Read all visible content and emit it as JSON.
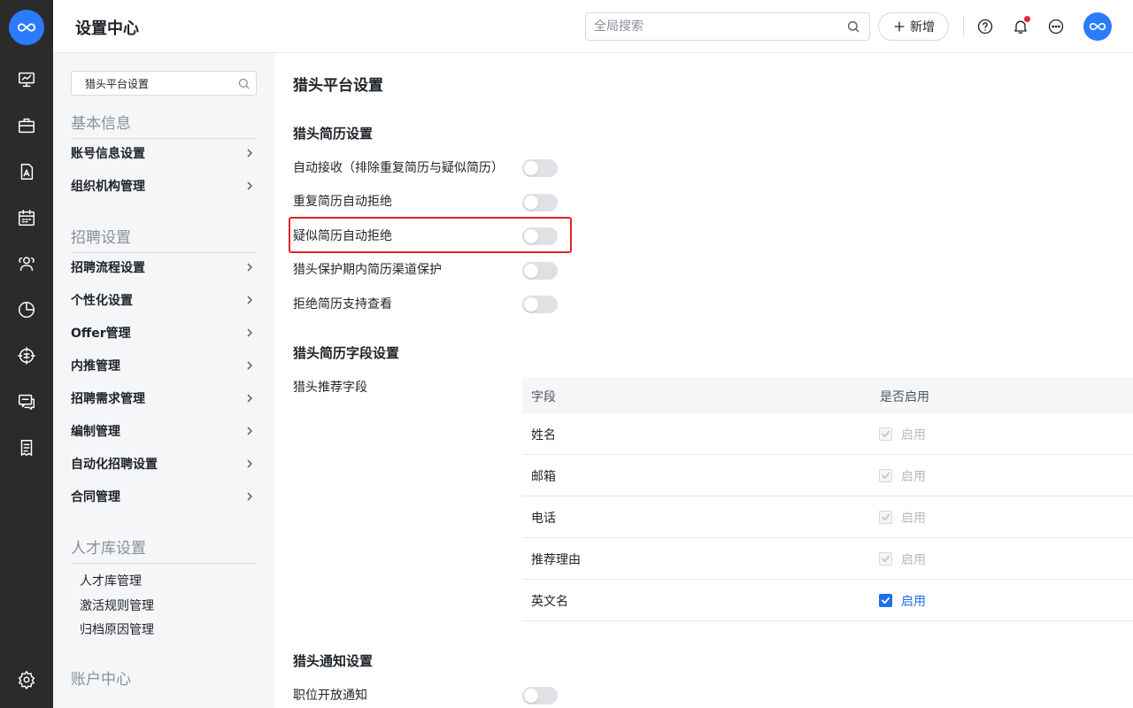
{
  "header": {
    "title": "设置中心",
    "search_placeholder": "全局搜索",
    "add_label": "新增",
    "icons": [
      "help-icon",
      "bell-icon",
      "more-icon"
    ],
    "accent": "#2b7bff"
  },
  "rail": {
    "icons": [
      "monitor-icon",
      "briefcase-icon",
      "resume-icon",
      "calendar-icon",
      "users-icon",
      "pie-chart-icon",
      "target-icon",
      "chat-icon",
      "document-icon",
      "settings-icon"
    ]
  },
  "sidebar": {
    "search_value": "猎头平台设置",
    "groups": [
      {
        "title": "基本信息",
        "items": [
          "账号信息设置",
          "组织机构管理"
        ]
      },
      {
        "title": "招聘设置",
        "items": [
          "招聘流程设置",
          "个性化设置",
          "Offer管理",
          "内推管理",
          "招聘需求管理",
          "编制管理",
          "自动化招聘设置",
          "合同管理"
        ]
      },
      {
        "title": "人才库设置",
        "items": [
          "人才库管理",
          "激活规则管理",
          "归档原因管理"
        ]
      },
      {
        "title": "账户中心",
        "items": []
      }
    ]
  },
  "main": {
    "title": "猎头平台设置",
    "sections": [
      {
        "title": "猎头简历设置",
        "settings": [
          {
            "label": "自动接收（排除重复简历与疑似简历）",
            "enabled": false
          },
          {
            "label": "重复简历自动拒绝",
            "enabled": false
          },
          {
            "label": "疑似简历自动拒绝",
            "enabled": false
          },
          {
            "label": "猎头保护期内简历渠道保护",
            "enabled": false
          },
          {
            "label": "拒绝简历支持查看",
            "enabled": false
          }
        ]
      },
      {
        "title": "猎头简历字段设置",
        "field_label": "猎头推荐字段",
        "table": {
          "headers": [
            "字段",
            "是否启用"
          ],
          "rows": [
            {
              "field": "姓名",
              "status": "启用",
              "checked": true,
              "disabled": true
            },
            {
              "field": "邮箱",
              "status": "启用",
              "checked": true,
              "disabled": true
            },
            {
              "field": "电话",
              "status": "启用",
              "checked": true,
              "disabled": true
            },
            {
              "field": "推荐理由",
              "status": "启用",
              "checked": true,
              "disabled": true
            },
            {
              "field": "英文名",
              "status": "启用",
              "checked": true,
              "disabled": false
            }
          ]
        }
      },
      {
        "title": "猎头通知设置",
        "settings": [
          {
            "label": "职位开放通知",
            "enabled": false
          }
        ]
      }
    ]
  },
  "colors": {
    "checkbox_active": "#1f6fe8",
    "highlight_border": "#e02424",
    "toggle_off": "#dfe1e5"
  }
}
